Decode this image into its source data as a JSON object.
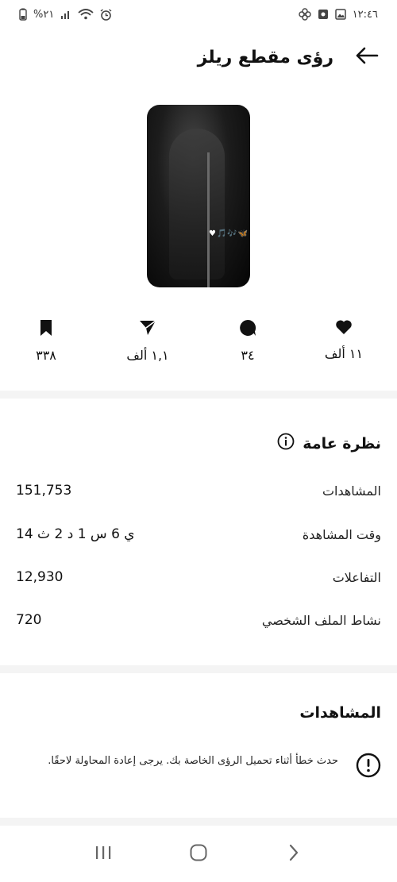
{
  "status_bar": {
    "battery": "%٢١",
    "time": "١٢:٤٦"
  },
  "header": {
    "title": "رؤى مقطع ريلز"
  },
  "reel": {
    "overlay_text": "♥🎵🎶🦋"
  },
  "engagement": {
    "likes": "١١ ألف",
    "comments": "٣٤",
    "shares": "١,١ ألف",
    "saves": "٣٣٨"
  },
  "overview": {
    "title": "نظرة عامة",
    "rows": [
      {
        "label": "المشاهدات",
        "value": "151,753"
      },
      {
        "label": "وقت المشاهدة",
        "value": "14 ي 6 س 1 د 2 ث"
      },
      {
        "label": "التفاعلات",
        "value": "12,930"
      },
      {
        "label": "نشاط الملف الشخصي",
        "value": "720"
      }
    ]
  },
  "views_section": {
    "title": "المشاهدات",
    "error": "حدث خطأ أثناء تحميل الرؤى الخاصة بك. يرجى إعادة المحاولة لاحقًا."
  },
  "colors": {
    "text": "#111111",
    "divider": "#f4f4f4",
    "background": "#ffffff"
  }
}
